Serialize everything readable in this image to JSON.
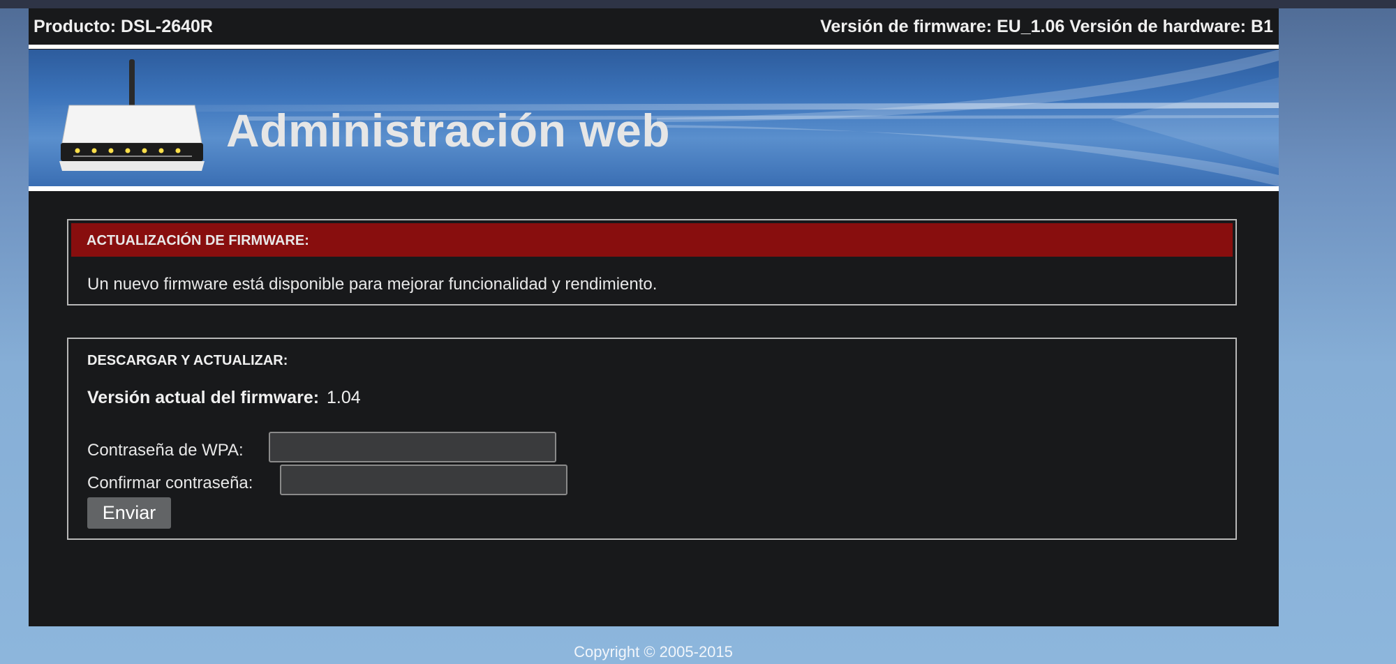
{
  "header": {
    "product": "Producto: DSL-2640R",
    "versions": "Versión de firmware: EU_1.06 Versión de hardware: B1"
  },
  "banner": {
    "title": "Administración web",
    "logo_icon": "router-icon"
  },
  "firmware_update": {
    "title": "ACTUALIZACIÓN DE FIRMWARE:",
    "message": "Un nuevo firmware está disponible para mejorar funcionalidad y rendimiento."
  },
  "download_update": {
    "title": "DESCARGAR Y ACTUALIZAR:",
    "current_version_label": "Versión actual del firmware:",
    "current_version_value": "1.04",
    "wpa_password_label": "Contraseña de WPA:",
    "wpa_password_value": "",
    "confirm_password_label": "Confirmar contraseña:",
    "confirm_password_value": "",
    "submit_label": "Enviar"
  },
  "footer": {
    "copyright": "Copyright © 2005-2015"
  },
  "colors": {
    "panel_background": "#18191b",
    "alert_bar": "#880e0e",
    "banner_blue": "#3c74bb",
    "button": "#626466"
  }
}
